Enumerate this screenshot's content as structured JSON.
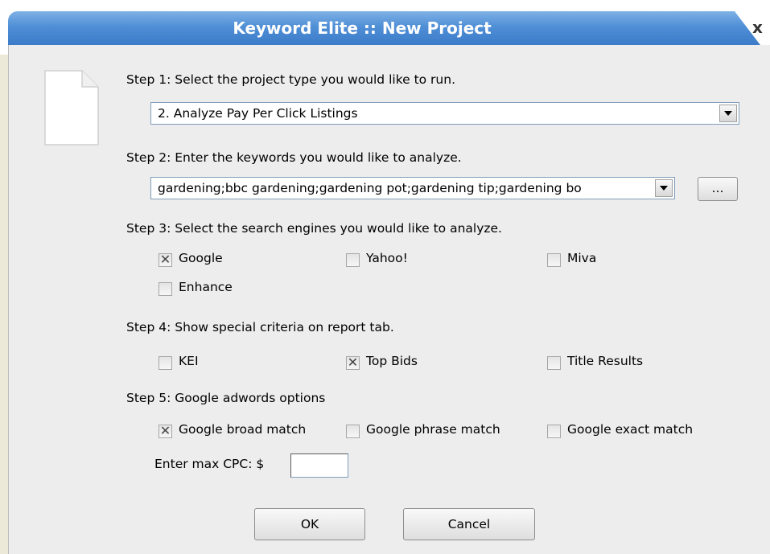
{
  "window": {
    "title": "Keyword Elite :: New Project",
    "close_label": "x"
  },
  "step1": {
    "label": "Step 1: Select the project type you would like to run.",
    "selected": "2. Analyze Pay Per Click Listings"
  },
  "step2": {
    "label": "Step 2: Enter the keywords you would like to analyze.",
    "value": "gardening;bbc gardening;gardening pot;gardening tip;gardening bo",
    "browse_label": "..."
  },
  "step3": {
    "label": "Step 3: Select the search engines you would like to analyze.",
    "engines": [
      {
        "label": "Google",
        "checked": true
      },
      {
        "label": "Yahoo!",
        "checked": false
      },
      {
        "label": "Miva",
        "checked": false
      },
      {
        "label": "Enhance",
        "checked": false
      }
    ]
  },
  "step4": {
    "label": "Step 4: Show special criteria on report tab.",
    "criteria": [
      {
        "label": "KEI",
        "checked": false
      },
      {
        "label": "Top Bids",
        "checked": true
      },
      {
        "label": "Title Results",
        "checked": false
      }
    ]
  },
  "step5": {
    "label": "Step 5: Google adwords options",
    "options": [
      {
        "label": "Google broad match",
        "checked": true
      },
      {
        "label": "Google phrase match",
        "checked": false
      },
      {
        "label": "Google exact match",
        "checked": false
      }
    ],
    "max_cpc_label": "Enter max CPC: $",
    "max_cpc_value": ""
  },
  "buttons": {
    "ok": "OK",
    "cancel": "Cancel"
  },
  "check_mark": "✕",
  "colors": {
    "title_bar": "#4f8fd6",
    "dialog_bg": "#ededed"
  }
}
